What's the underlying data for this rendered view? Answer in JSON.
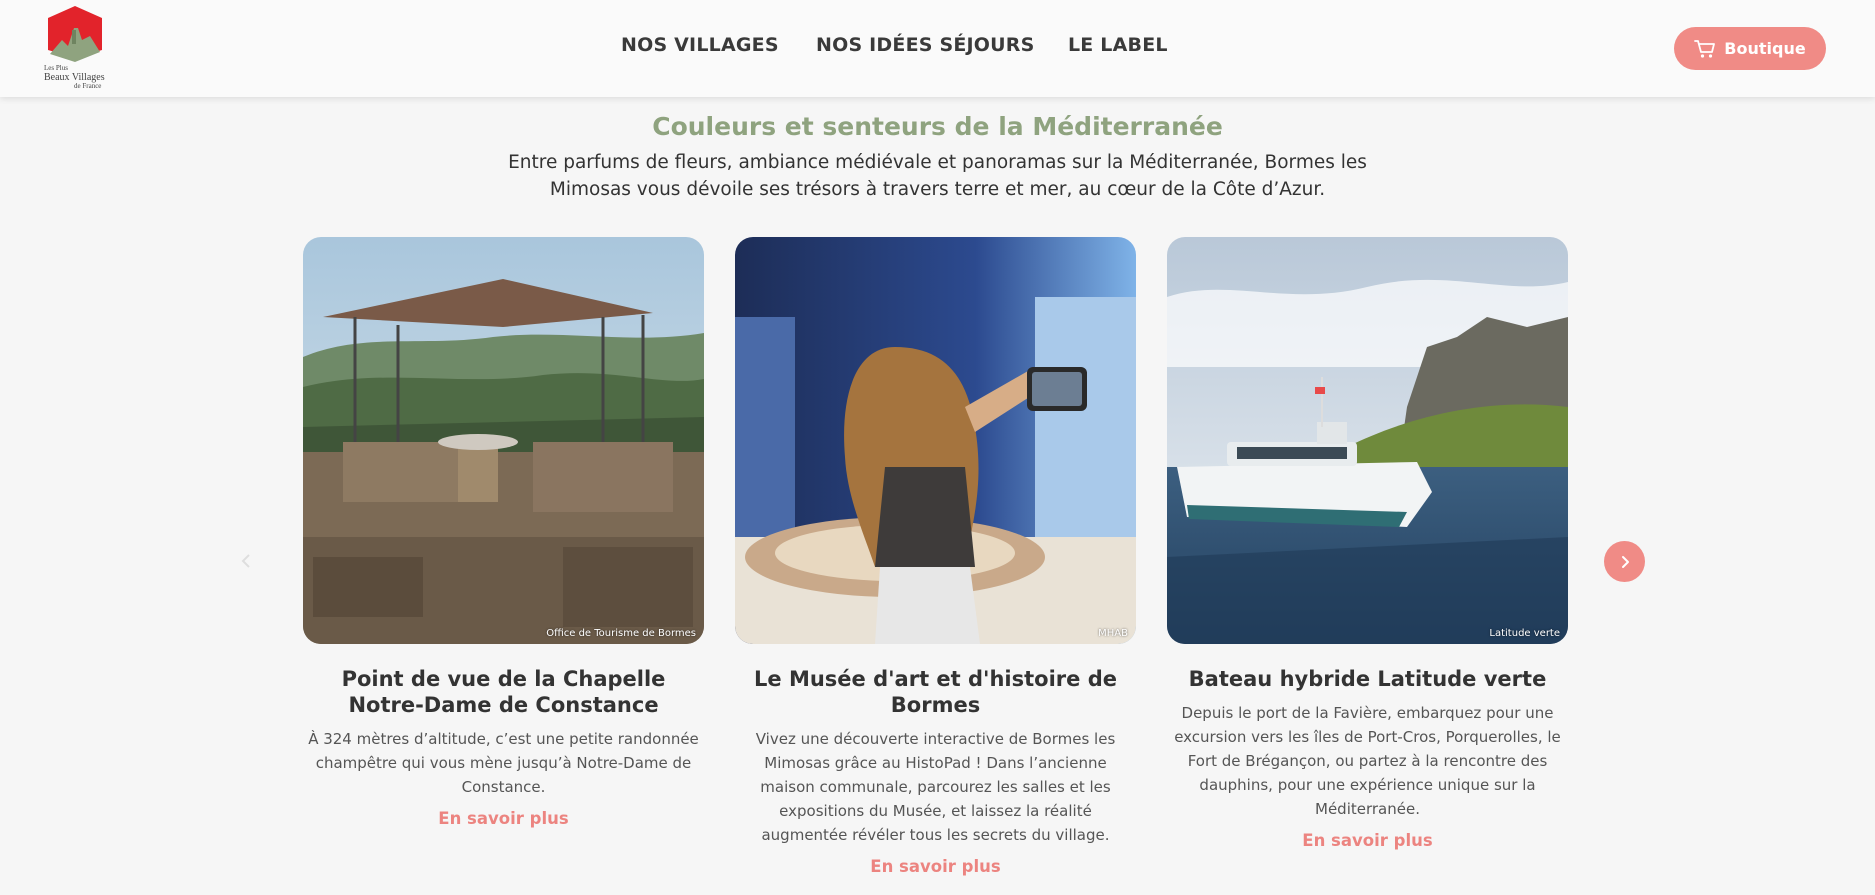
{
  "logo": {
    "line1": "Les Plus",
    "line2": "Beaux Villages",
    "line3": "de France",
    "icon": "village-logo-icon"
  },
  "nav": {
    "items": [
      "NOS VILLAGES",
      "NOS IDÉES SÉJOURS",
      "LE LABEL"
    ]
  },
  "shop": {
    "label": "Boutique",
    "icon": "cart-icon"
  },
  "section": {
    "title": "Couleurs et senteurs de la Méditerranée",
    "intro": "Entre parfums de fleurs, ambiance médiévale et panoramas sur la Méditerranée, Bormes les Mimosas vous dévoile ses trésors à travers terre et mer, au cœur de la Côte d’Azur."
  },
  "cards": [
    {
      "title": "Point de vue de la Chapelle Notre-Dame de Constance",
      "text": "À 324 mètres d’altitude, c’est une petite randonnée champêtre qui vous mène jusqu’à Notre-Dame de Constance.",
      "link": "En savoir plus",
      "credit": "Office de Tourisme de Bormes"
    },
    {
      "title": "Le Musée d'art et d'histoire de Bormes",
      "text": "Vivez une découverte interactive de Bormes les Mimosas grâce au HistoPad ! Dans l’ancienne maison communale, parcourez les salles et les expositions du Musée, et laissez la réalité augmentée révéler tous les secrets du village.",
      "link": "En savoir plus",
      "credit": "MHAB"
    },
    {
      "title": "Bateau hybride Latitude verte",
      "text": "Depuis le port de la Favière, embarquez pour une excursion vers les îles de Port-Cros, Porquerolles, le Fort de Brégançon, ou partez à la rencontre des dauphins, pour une expérience unique sur la Méditerranée.",
      "link": "En savoir plus",
      "credit": "Latitude verte"
    }
  ],
  "carousel": {
    "next_icon": "chevron-right-icon",
    "prev_icon": "chevron-left-icon"
  },
  "colors": {
    "accent": "#f08b86",
    "title_green": "#8fa37f",
    "background": "#f6f6f6"
  }
}
